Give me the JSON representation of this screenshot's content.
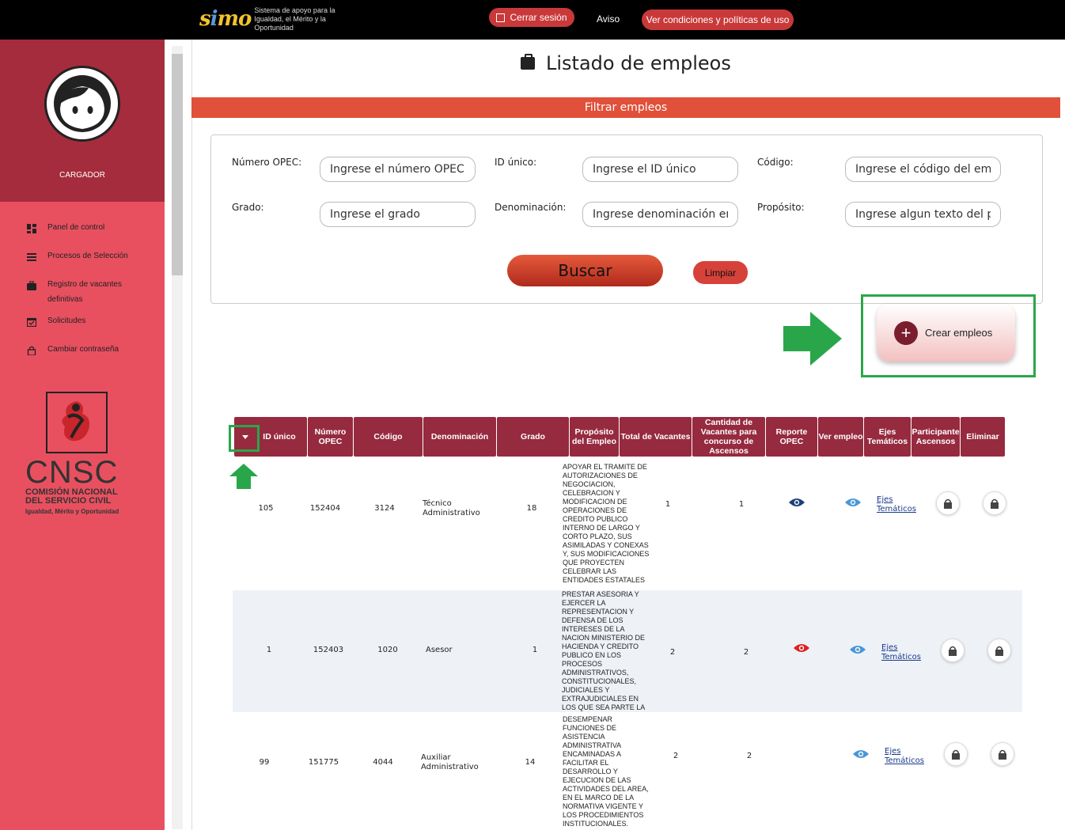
{
  "topbar": {
    "logo_mark": "simo",
    "logo_text": "Sistema de apoyo para la Igualdad, el Mérito y la Oportunidad",
    "logout_label": "Cerrar sesión",
    "aviso_label": "Aviso",
    "terms_label": "Ver condiciones y políticas de uso"
  },
  "sidebar": {
    "role": "CARGADOR",
    "items": [
      {
        "label": "Panel de control",
        "icon": "dashboard-icon"
      },
      {
        "label": "Procesos de Selección",
        "icon": "list-icon"
      },
      {
        "label": "Registro de vacantes definitivas",
        "icon": "briefcase-icon"
      },
      {
        "label": "Solicitudes",
        "icon": "calendar-check-icon"
      },
      {
        "label": "Cambiar contraseña",
        "icon": "lock-icon"
      }
    ],
    "cnsc": {
      "abbr": "CNSC",
      "line1": "COMISIÓN NACIONAL",
      "line2": "DEL SERVICIO CIVIL",
      "tagline": "Igualdad, Mérito y Oportunidad"
    }
  },
  "page": {
    "title": "Listado de empleos"
  },
  "filter": {
    "header": "Filtrar empleos",
    "fields": [
      {
        "label": "Número OPEC:",
        "placeholder": "Ingrese el número OPEC"
      },
      {
        "label": "ID único:",
        "placeholder": "Ingrese el ID único"
      },
      {
        "label": "Código:",
        "placeholder": "Ingrese el código del empleo"
      },
      {
        "label": "Grado:",
        "placeholder": "Ingrese el grado"
      },
      {
        "label": "Denominación:",
        "placeholder": "Ingrese denominación empleo"
      },
      {
        "label": "Propósito:",
        "placeholder": "Ingrese algun texto del propósito"
      }
    ],
    "search_label": "Buscar",
    "clear_label": "Limpiar"
  },
  "crear": {
    "label": "Crear empleos"
  },
  "table": {
    "headers": [
      "ID único",
      "Número OPEC",
      "Código",
      "Denominación",
      "Grado",
      "Propósito del Empleo",
      "Total de Vacantes",
      "Cantidad de Vacantes para concurso de Ascensos",
      "Reporte OPEC",
      "Ver empleo",
      "Ejes Temáticos",
      "Participante Ascensos",
      "Eliminar"
    ],
    "ejes_link": "Ejes Temáticos",
    "rows": [
      {
        "id": "105",
        "opec": "152404",
        "codigo": "3124",
        "denominacion": "Técnico Administrativo",
        "grado": "18",
        "proposito": "APOYAR EL TRAMITE DE AUTORIZACIONES DE NEGOCIACION, CELEBRACION Y MODIFICACION DE OPERACIONES DE CREDITO PUBLICO INTERNO DE LARGO Y CORTO PLAZO, SUS ASIMILADAS Y CONEXAS Y, SUS MODIFICACIONES QUE PROYECTEN CELEBRAR LAS ENTIDADES ESTATALES",
        "total": "1",
        "ascensos": "1",
        "reporte": "dark"
      },
      {
        "id": "1",
        "opec": "152403",
        "codigo": "1020",
        "denominacion": "Asesor",
        "grado": "1",
        "proposito": "PRESTAR ASESORIA Y EJERCER LA REPRESENTACION Y DEFENSA DE LOS INTERESES DE LA NACION MINISTERIO DE HACIENDA Y CREDITO PUBLICO EN LOS PROCESOS ADMINISTRATIVOS, CONSTITUCIONALES, JUDICIALES Y EXTRAJUDICIALES EN LOS QUE SEA PARTE LA",
        "total": "2",
        "ascensos": "2",
        "reporte": "red"
      },
      {
        "id": "99",
        "opec": "151775",
        "codigo": "4044",
        "denominacion": "Auxiliar Administrativo",
        "grado": "14",
        "proposito": "DESEMPENAR FUNCIONES DE ASISTENCIA ADMINISTRATIVA ENCAMINADAS A FACILITAR EL DESARROLLO Y EJECUCION DE LAS ACTIVIDADES DEL AREA, EN EL MARCO DE LA NORMATIVA VIGENTE Y LOS PROCEDIMIENTOS INSTITUCIONALES.",
        "total": "2",
        "ascensos": "2",
        "reporte": "none"
      }
    ]
  },
  "colors": {
    "sidebar": "#e85060",
    "sidebar_head": "#a52c3c",
    "table_header": "#962a3f",
    "filter_header": "#e0503a",
    "highlight": "#2aa64a"
  }
}
